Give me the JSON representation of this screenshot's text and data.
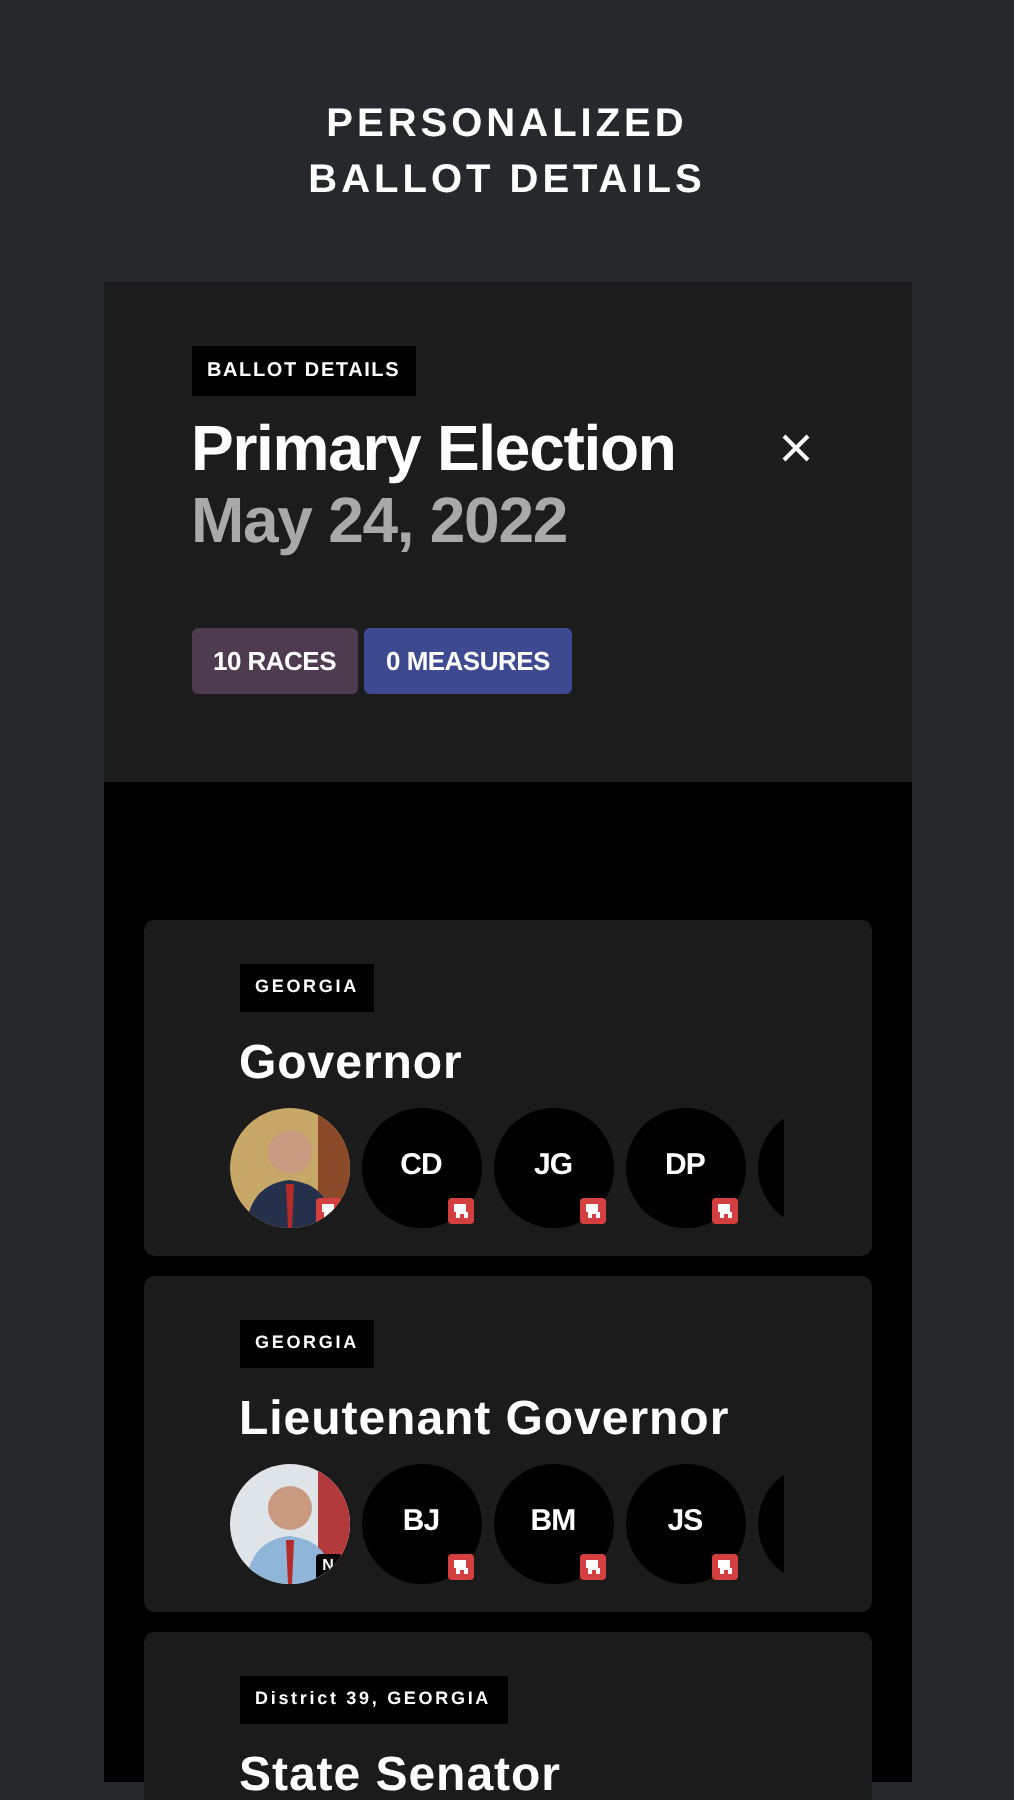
{
  "page_title": "PERSONALIZED BALLOT DETAILS",
  "panel": {
    "tag": "BALLOT DETAILS",
    "title": "Primary Election",
    "date": "May 24, 2022",
    "chips": [
      {
        "label": "10 RACES",
        "color": "#4e3b50"
      },
      {
        "label": "0 MEASURES",
        "color": "#3e4a90"
      }
    ]
  },
  "races": [
    {
      "region": "GEORGIA",
      "title": "Governor",
      "candidates": [
        {
          "kind": "picture",
          "badge": {
            "kind": "icon"
          }
        },
        {
          "kind": "initials",
          "initials": "CD",
          "badge": {
            "kind": "icon"
          }
        },
        {
          "kind": "initials",
          "initials": "JG",
          "badge": {
            "kind": "icon"
          }
        },
        {
          "kind": "initials",
          "initials": "DP",
          "badge": {
            "kind": "icon"
          }
        },
        {
          "kind": "blank"
        }
      ]
    },
    {
      "region": "GEORGIA",
      "title": "Lieutenant Governor",
      "candidates": [
        {
          "kind": "picture",
          "badge": {
            "kind": "letter",
            "text": "N"
          }
        },
        {
          "kind": "initials",
          "initials": "BJ",
          "badge": {
            "kind": "icon"
          }
        },
        {
          "kind": "initials",
          "initials": "BM",
          "badge": {
            "kind": "icon"
          }
        },
        {
          "kind": "initials",
          "initials": "JS",
          "badge": {
            "kind": "icon"
          }
        },
        {
          "kind": "blank"
        }
      ]
    },
    {
      "region": "District 39, GEORGIA",
      "title": "State Senator"
    }
  ]
}
